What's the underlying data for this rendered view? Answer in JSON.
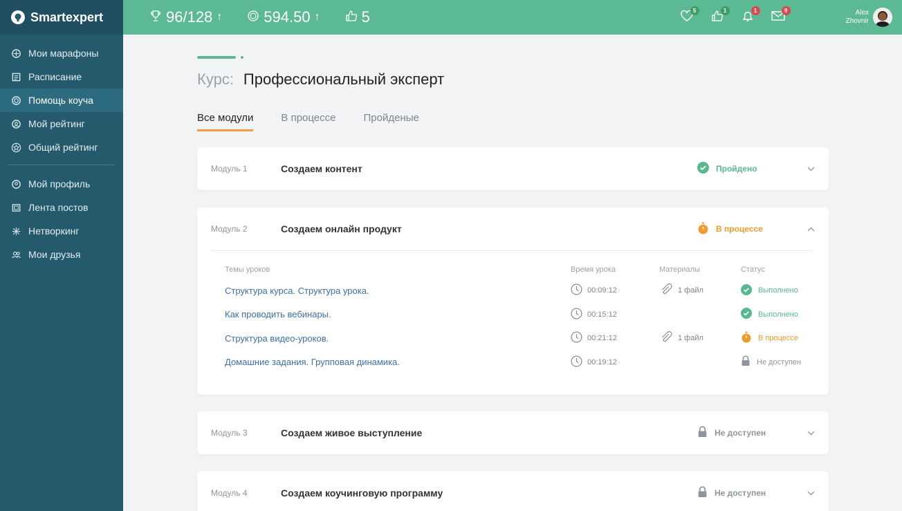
{
  "brand": {
    "name": "Smartexpert"
  },
  "sidebar": {
    "items": [
      {
        "label": "Мои марафоны",
        "icon": "marathon-icon"
      },
      {
        "label": "Расписание",
        "icon": "calendar-icon"
      },
      {
        "label": "Помощь коуча",
        "icon": "lifebuoy-icon"
      },
      {
        "label": "Мой рейтинг",
        "icon": "user-rating-icon"
      },
      {
        "label": "Общий рейтинг",
        "icon": "star-icon"
      },
      {
        "label": "Мой профиль",
        "icon": "profile-icon"
      },
      {
        "label": "Лента постов",
        "icon": "feed-icon"
      },
      {
        "label": "Нетворкинг",
        "icon": "network-icon"
      },
      {
        "label": "Мои друзья",
        "icon": "friends-icon"
      }
    ]
  },
  "topbar": {
    "stats": [
      {
        "icon": "trophy-icon",
        "value": "96/128",
        "arrow": "↑"
      },
      {
        "icon": "coins-icon",
        "value": "594.50",
        "arrow": "↑"
      },
      {
        "icon": "thumbs-up-icon",
        "value": "5"
      }
    ],
    "notifications": [
      {
        "icon": "heart-icon",
        "count": "5",
        "color": "#3d9d63"
      },
      {
        "icon": "like-icon",
        "count": "1",
        "color": "#3d9d63"
      },
      {
        "icon": "bell-icon",
        "count": "1",
        "color": "#e0474c"
      },
      {
        "icon": "mail-icon",
        "count": "9",
        "color": "#e0474c"
      }
    ],
    "user": {
      "first": "Alex",
      "last": "Zhovnir"
    }
  },
  "course": {
    "prefix": "Курс:",
    "title": "Профессиональный эксперт"
  },
  "tabs": [
    {
      "label": "Все модули"
    },
    {
      "label": "В процессе"
    },
    {
      "label": "Пройденые"
    }
  ],
  "modules": [
    {
      "number": "Модуль 1",
      "name": "Создаем контент",
      "status": "Пройдено",
      "state": "done"
    },
    {
      "number": "Модуль 2",
      "name": "Создаем онлайн продукт",
      "status": "В процессе",
      "state": "progress"
    },
    {
      "number": "Модуль 3",
      "name": "Создаем живое выступление",
      "status": "Не доступен",
      "state": "locked"
    },
    {
      "number": "Модуль 4",
      "name": "Создаем коучинговую программу",
      "status": "Не доступен",
      "state": "locked"
    }
  ],
  "lessons": {
    "headers": {
      "topic": "Темы уроков",
      "time": "Время урока",
      "materials": "Материалы",
      "status": "Статус"
    },
    "rows": [
      {
        "topic": "Структура курса. Структура урока.",
        "time": "00:09:12",
        "materials": "1 файл",
        "status": "Выполнено",
        "state": "done"
      },
      {
        "topic": "Как проводить вебинары.",
        "time": "00:15:12",
        "materials": "",
        "status": "Выполнено",
        "state": "done"
      },
      {
        "topic": "Структура видео-уроков.",
        "time": "00:21:12",
        "materials": "1 файл",
        "status": "В процессе",
        "state": "progress"
      },
      {
        "topic": "Домашние задания. Групповая динамика.",
        "time": "00:19:12",
        "materials": "",
        "status": "Не доступен",
        "state": "locked"
      }
    ]
  },
  "colors": {
    "sidebar": "#245a6c",
    "topbar": "#5bb993",
    "done": "#58b98f",
    "progress": "#f19b2c",
    "locked": "#8e959c",
    "link": "#3b6fae"
  }
}
